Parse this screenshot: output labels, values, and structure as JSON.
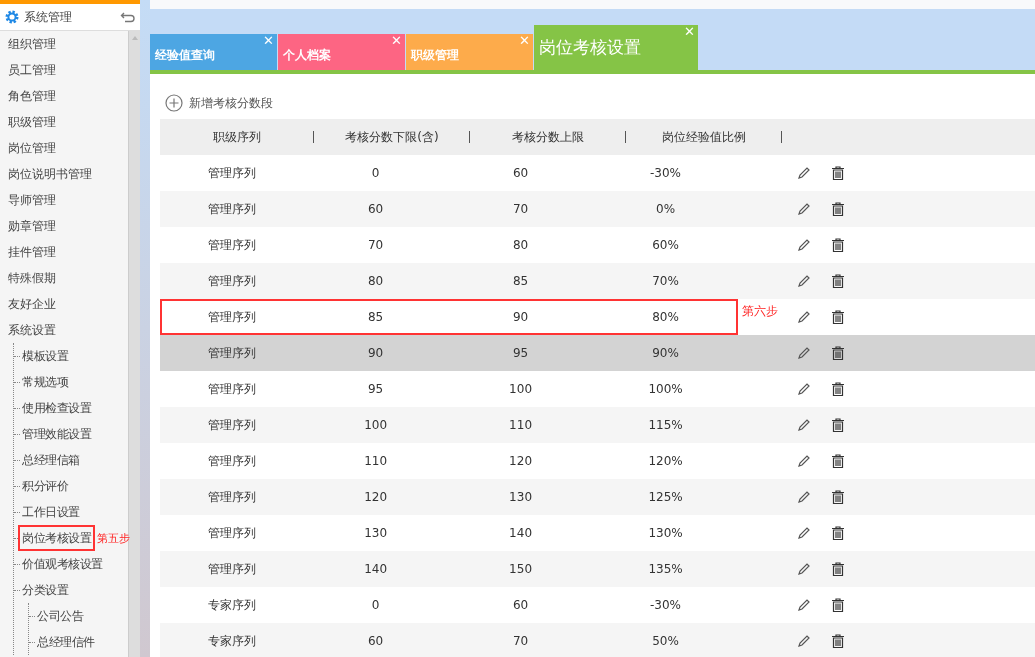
{
  "sidebar": {
    "title": "系统管理",
    "items": [
      {
        "label": "组织管理"
      },
      {
        "label": "员工管理"
      },
      {
        "label": "角色管理"
      },
      {
        "label": "职级管理"
      },
      {
        "label": "岗位管理"
      },
      {
        "label": "岗位说明书管理"
      },
      {
        "label": "导师管理"
      },
      {
        "label": "勋章管理"
      },
      {
        "label": "挂件管理"
      },
      {
        "label": "特殊假期"
      },
      {
        "label": "友好企业"
      },
      {
        "label": "系统设置",
        "children": [
          {
            "label": "模板设置"
          },
          {
            "label": "常规选项"
          },
          {
            "label": "使用检查设置"
          },
          {
            "label": "管理效能设置"
          },
          {
            "label": "总经理信箱"
          },
          {
            "label": "积分评价"
          },
          {
            "label": "工作日设置"
          },
          {
            "label": "岗位考核设置",
            "highlighted": true,
            "note": "第五步"
          },
          {
            "label": "价值观考核设置"
          },
          {
            "label": "分类设置",
            "children": [
              {
                "label": "公司公告"
              },
              {
                "label": "总经理信件"
              }
            ]
          }
        ]
      }
    ]
  },
  "tabs": [
    {
      "label": "经验值查询",
      "color": "#4da6e3",
      "selected": false,
      "close": "✕"
    },
    {
      "label": "个人档案",
      "color": "#fd6583",
      "selected": false,
      "close": "✕"
    },
    {
      "label": "职级管理",
      "color": "#fdab4b",
      "selected": false,
      "close": "✕"
    },
    {
      "label": "岗位考核设置",
      "color": "#85c446",
      "selected": true,
      "close": "✕"
    }
  ],
  "add_button": "新增考核分数段",
  "table": {
    "columns": [
      "职级序列",
      "考核分数下限(含)",
      "考核分数上限",
      "岗位经验值比例"
    ],
    "rows": [
      {
        "cells": [
          "管理序列",
          "0",
          "60",
          "-30%"
        ],
        "hovered": false,
        "highlighted": false
      },
      {
        "cells": [
          "管理序列",
          "60",
          "70",
          "0%"
        ],
        "hovered": false,
        "highlighted": false
      },
      {
        "cells": [
          "管理序列",
          "70",
          "80",
          "60%"
        ],
        "hovered": false,
        "highlighted": false
      },
      {
        "cells": [
          "管理序列",
          "80",
          "85",
          "70%"
        ],
        "hovered": false,
        "highlighted": false
      },
      {
        "cells": [
          "管理序列",
          "85",
          "90",
          "80%"
        ],
        "hovered": false,
        "highlighted": true,
        "note": "第六步"
      },
      {
        "cells": [
          "管理序列",
          "90",
          "95",
          "90%"
        ],
        "hovered": true,
        "highlighted": false
      },
      {
        "cells": [
          "管理序列",
          "95",
          "100",
          "100%"
        ],
        "hovered": false,
        "highlighted": false
      },
      {
        "cells": [
          "管理序列",
          "100",
          "110",
          "115%"
        ],
        "hovered": false,
        "highlighted": false
      },
      {
        "cells": [
          "管理序列",
          "110",
          "120",
          "120%"
        ],
        "hovered": false,
        "highlighted": false
      },
      {
        "cells": [
          "管理序列",
          "120",
          "130",
          "125%"
        ],
        "hovered": false,
        "highlighted": false
      },
      {
        "cells": [
          "管理序列",
          "130",
          "140",
          "130%"
        ],
        "hovered": false,
        "highlighted": false
      },
      {
        "cells": [
          "管理序列",
          "140",
          "150",
          "135%"
        ],
        "hovered": false,
        "highlighted": false
      },
      {
        "cells": [
          "专家序列",
          "0",
          "60",
          "-30%"
        ],
        "hovered": false,
        "highlighted": false
      },
      {
        "cells": [
          "专家序列",
          "60",
          "70",
          "50%"
        ],
        "hovered": false,
        "highlighted": false
      }
    ]
  }
}
